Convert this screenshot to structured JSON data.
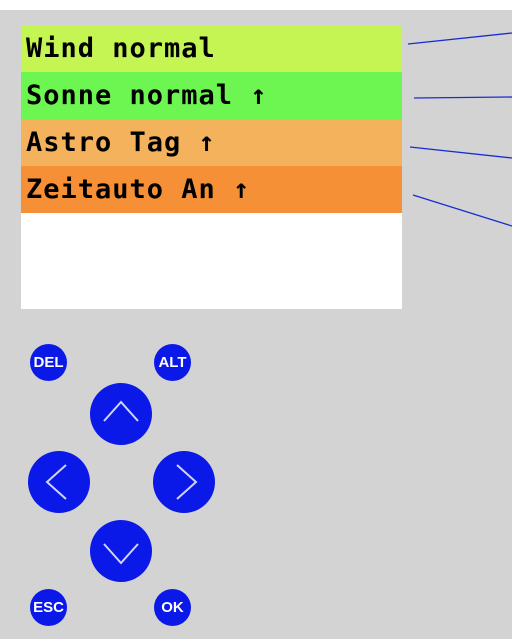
{
  "display": {
    "lines": [
      {
        "text": "Wind normal",
        "color": "#c4f552"
      },
      {
        "text": "Sonne normal ↑",
        "color": "#6df552"
      },
      {
        "text": "Astro Tag ↑",
        "color": "#f5b25c"
      },
      {
        "text": "Zeitauto An ↑",
        "color": "#f59037"
      }
    ]
  },
  "keys": {
    "del": "DEL",
    "alt": "ALT",
    "esc": "ESC",
    "ok": "OK",
    "up": "chevron-up-icon",
    "down": "chevron-down-icon",
    "left": "chevron-left-icon",
    "right": "chevron-right-icon"
  },
  "colors": {
    "panel": "#d3d3d3",
    "key": "#0a19e8",
    "arrow": "#1a2bd6"
  }
}
